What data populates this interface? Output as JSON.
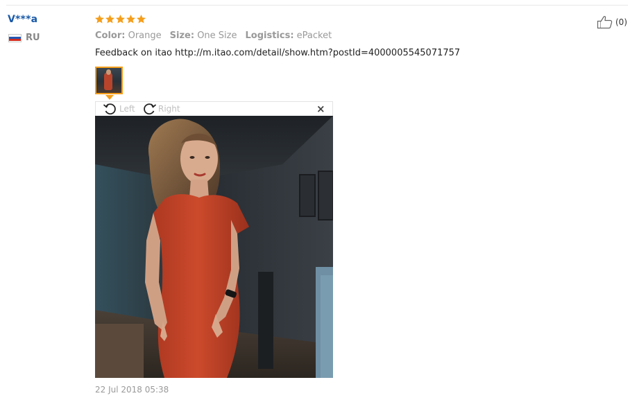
{
  "review": {
    "buyer_name": "V***a",
    "country_code": "RU",
    "rating_stars": 5,
    "rating_max": 5,
    "colors": {
      "star": "#f59e1b",
      "buyer_name": "#1a5aa8",
      "thumb_border": "#f59e1b",
      "flag_white": "#ffffff",
      "flag_blue": "#2457b3",
      "flag_red": "#d52b1e"
    },
    "attributes": [
      {
        "label": "Color:",
        "value": "Orange"
      },
      {
        "label": "Size:",
        "value": "One Size"
      },
      {
        "label": "Logistics:",
        "value": "ePacket"
      }
    ],
    "feedback": "Feedback on itao http://m.itao.com/detail/show.htm?postId=4000005545071757",
    "helpful_count": "(0)",
    "date": "22 Jul 2018 05:38"
  },
  "viewer": {
    "rotate_left_label": "Left",
    "rotate_right_label": "Right",
    "close_symbol": "×",
    "icons": {
      "rotate_left": "rotate-left-icon",
      "rotate_right": "rotate-right-icon",
      "close": "close-icon",
      "thumbs_up": "thumbs-up-icon",
      "star": "star-icon",
      "flag": "flag-ru-icon"
    }
  }
}
